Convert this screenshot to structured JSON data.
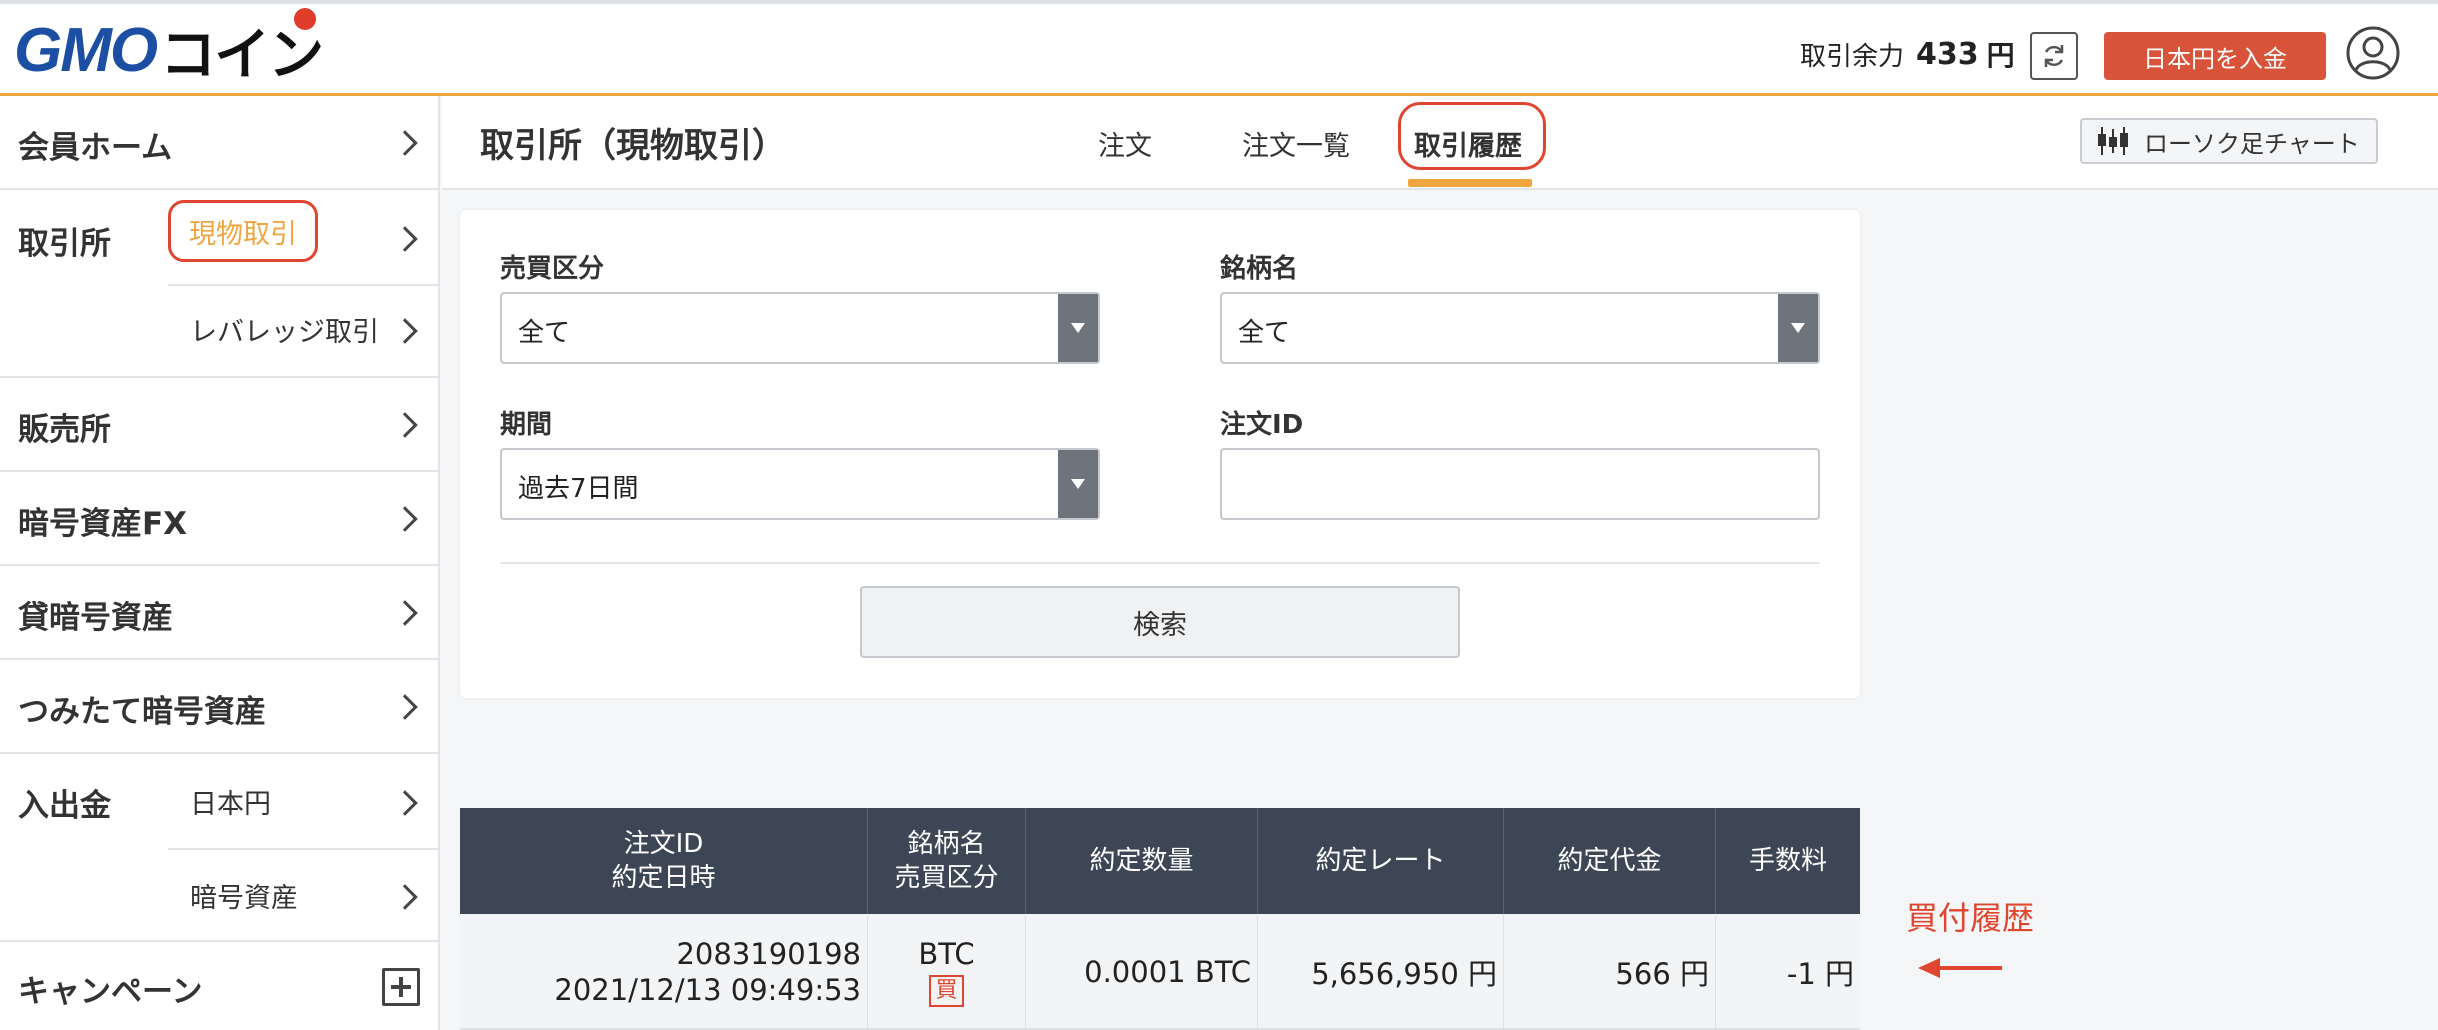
{
  "header": {
    "logo_brand": "GMO",
    "logo_product": "コイン",
    "balance_label": "取引余力",
    "balance_value": "433",
    "balance_unit": "円",
    "deposit_button": "日本円を入金"
  },
  "sidebar": {
    "member_home": "会員ホーム",
    "exchange": "取引所",
    "exchange_spot": "現物取引",
    "exchange_leverage": "レバレッジ取引",
    "sales": "販売所",
    "crypto_fx": "暗号資産FX",
    "lending": "貸暗号資産",
    "tsumitate": "つみたて暗号資産",
    "deposit_withdraw": "入出金",
    "dw_jpy": "日本円",
    "dw_crypto": "暗号資産",
    "campaign": "キャンペーン"
  },
  "main": {
    "title": "取引所（現物取引）",
    "tabs": [
      {
        "label": "注文",
        "active": false
      },
      {
        "label": "注文一覧",
        "active": false
      },
      {
        "label": "取引履歴",
        "active": true
      }
    ],
    "chart_button": "ローソク足チャート"
  },
  "filters": {
    "side_label": "売買区分",
    "side_value": "全て",
    "symbol_label": "銘柄名",
    "symbol_value": "全て",
    "period_label": "期間",
    "period_value": "過去7日間",
    "order_id_label": "注文ID",
    "order_id_value": "",
    "search_button": "検索"
  },
  "table": {
    "headers": {
      "order_id": "注文ID",
      "exec_date": "約定日時",
      "symbol": "銘柄名",
      "side": "売買区分",
      "quantity": "約定数量",
      "rate": "約定レート",
      "amount": "約定代金",
      "fee": "手数料"
    },
    "rows": [
      {
        "order_id": "2083190198",
        "exec_date": "2021/12/13 09:49:53",
        "symbol": "BTC",
        "side": "買",
        "quantity": "0.0001 BTC",
        "rate": "5,656,950 円",
        "amount": "566 円",
        "fee": "-1 円"
      }
    ]
  },
  "annotation": {
    "label": "買付履歴"
  },
  "colors": {
    "brand_blue": "#1c4fa3",
    "accent_orange": "#f0a640",
    "highlight_red": "#e0452f",
    "table_header": "#3d4654",
    "deposit_red": "#d9533a"
  }
}
